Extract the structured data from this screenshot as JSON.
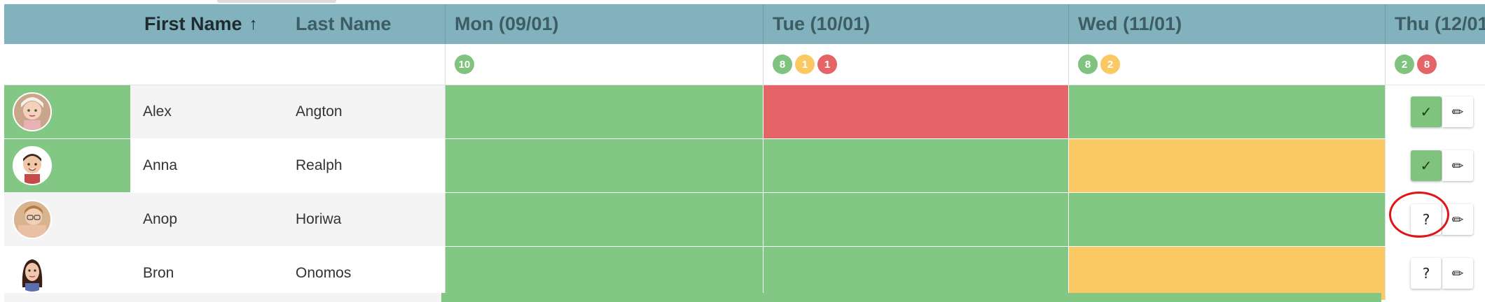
{
  "columns": {
    "first_name": "First Name",
    "first_name_sort_icon": "arrow-up-icon",
    "last_name": "Last Name",
    "days": [
      "Mon (09/01)",
      "Tue (10/01)",
      "Wed (11/01)",
      "Thu (12/01"
    ]
  },
  "summary": [
    [
      {
        "count": "10",
        "status": "green"
      }
    ],
    [
      {
        "count": "8",
        "status": "green"
      },
      {
        "count": "1",
        "status": "yellow"
      },
      {
        "count": "1",
        "status": "red"
      }
    ],
    [
      {
        "count": "8",
        "status": "green"
      },
      {
        "count": "2",
        "status": "yellow"
      }
    ],
    [
      {
        "count": "2",
        "status": "green"
      },
      {
        "count": "8",
        "status": "red"
      }
    ]
  ],
  "rows": [
    {
      "first": "Alex",
      "last": "Angton",
      "avatar_highlight": true,
      "days": [
        "green",
        "red",
        "green"
      ],
      "thu_button": "✓",
      "thu_answered": true
    },
    {
      "first": "Anna",
      "last": "Realph",
      "avatar_highlight": true,
      "days": [
        "green",
        "green",
        "yellow"
      ],
      "thu_button": "✓",
      "thu_answered": true
    },
    {
      "first": "Anop",
      "last": "Horiwa",
      "avatar_highlight": false,
      "days": [
        "green",
        "green",
        "green"
      ],
      "thu_button": "?",
      "thu_answered": false
    },
    {
      "first": "Bron",
      "last": "Onomos",
      "avatar_highlight": false,
      "days": [
        "green",
        "green",
        "yellow"
      ],
      "thu_button": "?",
      "thu_answered": false
    }
  ],
  "colors": {
    "green": "#82c884",
    "yellow": "#fcca64",
    "red": "#e46468",
    "header": "#81b2bd",
    "annotation": "#e01515"
  }
}
